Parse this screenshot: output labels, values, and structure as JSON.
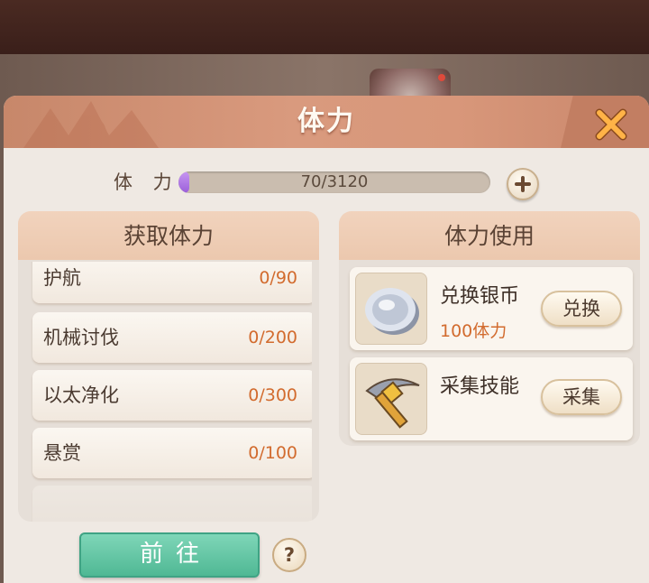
{
  "panel": {
    "title": "体力",
    "close_icon": "close-x-icon"
  },
  "stamina": {
    "label": "体 力",
    "value_text": "70/3120",
    "current": 70,
    "max": 3120,
    "fill_color": "#b07ae6"
  },
  "gain_panel": {
    "title": "获取体力",
    "tasks": [
      {
        "name": "护航",
        "progress": "0/90"
      },
      {
        "name": "机械讨伐",
        "progress": "0/200"
      },
      {
        "name": "以太净化",
        "progress": "0/300"
      },
      {
        "name": "悬赏",
        "progress": "0/100"
      }
    ]
  },
  "use_panel": {
    "title": "体力使用",
    "items": [
      {
        "title": "兑换银币",
        "cost": "100体力",
        "button": "兑换",
        "icon": "silver-coin-icon"
      },
      {
        "title": "采集技能",
        "cost": "",
        "button": "采集",
        "icon": "pickaxe-icon"
      }
    ]
  },
  "footer": {
    "go_button": "前往",
    "help_button": "?"
  },
  "colors": {
    "header": "#d99a7e",
    "accent_orange": "#d26b2e",
    "go_green": "#5cc4a0"
  }
}
